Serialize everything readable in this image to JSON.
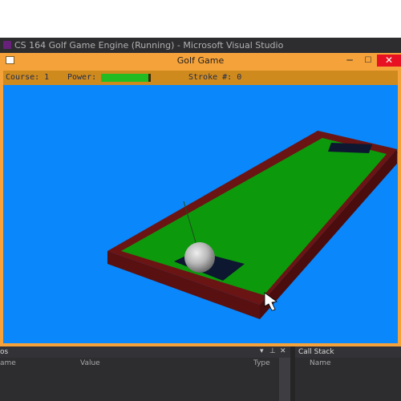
{
  "vs": {
    "title": "CS 164 Golf Game Engine (Running) - Microsoft Visual Studio"
  },
  "window": {
    "title": "Golf Game",
    "minimize": "─",
    "maximize": "☐",
    "close": "✕"
  },
  "hud": {
    "course_label": "Course: 1",
    "power_label": "Power:",
    "power_level": 0.95,
    "stroke_label": "Stroke #: 0"
  },
  "debug": {
    "autos_title": "os",
    "callstack_title": "Call Stack",
    "columns": {
      "name": "ame",
      "value": "Value",
      "type": "Type",
      "callstack_name": "Name"
    },
    "controls": {
      "dropdown": "▾",
      "pin": "⊥",
      "close": "✕"
    }
  },
  "colors": {
    "sky": "#0a87fa",
    "green": "#0c9a0c",
    "wall": "#6b1414",
    "hole": "#0d1730",
    "window_frame": "#f6a23a",
    "power_fill": "#22bb22"
  }
}
